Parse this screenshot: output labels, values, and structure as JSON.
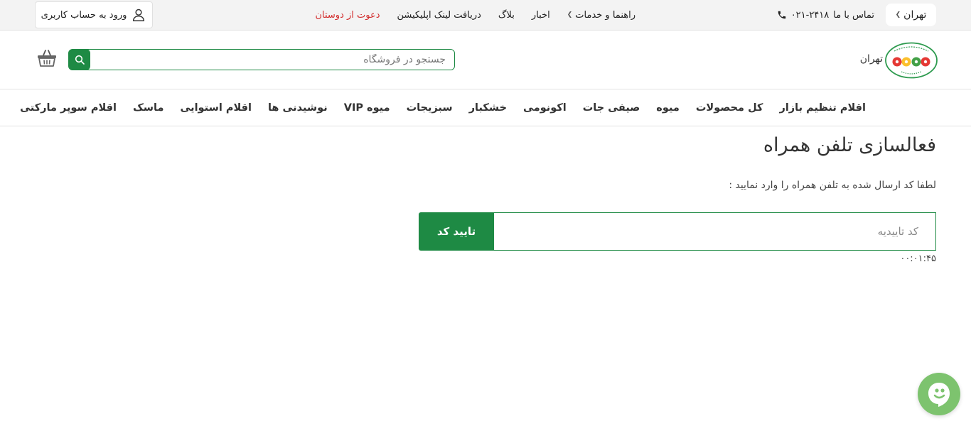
{
  "topbar": {
    "city": "تهران",
    "contact_label": "تماس با ما",
    "phone": "۰۲۱-۲۴۱۸",
    "nav": {
      "guide": "راهنما و خدمات",
      "news": "اخبار",
      "blog": "بلاگ",
      "app_link": "دریافت لینک اپلیکیشن",
      "invite": "دعوت از دوستان"
    },
    "login": "ورود به حساب کاربری"
  },
  "header": {
    "logo_city": "تهران",
    "search_placeholder": "جستجو در فروشگاه"
  },
  "categories": [
    "اقلام تنظیم بازار",
    "کل محصولات",
    "میوه",
    "صیفی جات",
    "اکونومی",
    "خشکبار",
    "سبزیجات",
    "میوه VIP",
    "نوشیدنی ها",
    "اقلام استوایی",
    "ماسک",
    "اقلام سوپر مارکتی"
  ],
  "main": {
    "title": "فعالسازی تلفن همراه",
    "instruction": "لطفا کد ارسال شده به تلفن همراه را وارد نمایید :",
    "code_placeholder": "کد تاییدیه",
    "confirm_label": "تایید کد",
    "timer": "۰۰:۰۱:۴۵"
  },
  "colors": {
    "brand_green": "#1e8a44",
    "invite_red": "#d32f2f",
    "chat_green": "#7dc36e"
  }
}
